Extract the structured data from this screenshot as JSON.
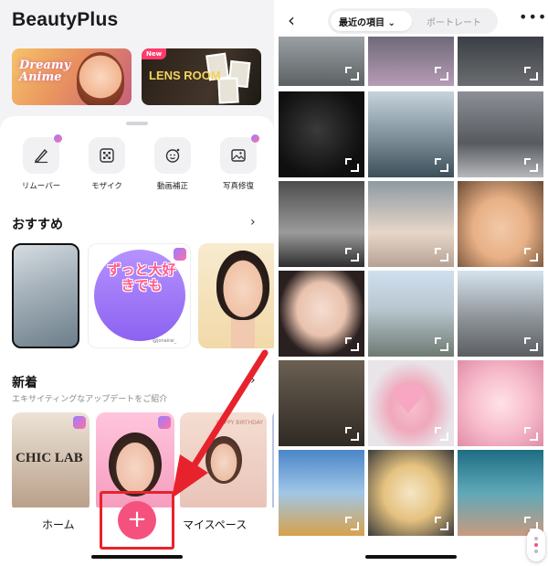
{
  "left": {
    "app_title": "BeautyPlus",
    "banners": {
      "anime_text": "Dreamy Anime",
      "lens_text": "LENS ROOM",
      "lens_badge": "New"
    },
    "tools": [
      {
        "label": "リムーバー",
        "icon": "eraser-icon"
      },
      {
        "label": "モザイク",
        "icon": "mosaic-icon"
      },
      {
        "label": "動画補正",
        "icon": "face-retouch-icon"
      },
      {
        "label": "写真修復",
        "icon": "photo-repair-icon"
      }
    ],
    "recommend": {
      "title": "おすすめ",
      "sticker_text": "ずっと大好きでも",
      "sticker_caption": "@jonairai_"
    },
    "new_section": {
      "title": "新着",
      "subtitle": "エキサイティングなアップデートをご紹介",
      "card1_text": "CHIC LAB",
      "card3_text": "HAPPY BIRTHDAY"
    },
    "tabbar": {
      "home": "ホーム",
      "add": "+",
      "my_space": "マイスペース"
    },
    "colors": {
      "accent": "#f5517e",
      "highlight": "#e8222c"
    }
  },
  "right": {
    "segment": {
      "active": "最近の項目",
      "inactive": "ポートレート"
    },
    "photos": [
      {
        "name": "photo-street-crosswalk"
      },
      {
        "name": "photo-purple-flowers"
      },
      {
        "name": "photo-dark-window"
      },
      {
        "name": "photo-shadow-sign"
      },
      {
        "name": "photo-city-bay"
      },
      {
        "name": "photo-crosswalk-city"
      },
      {
        "name": "photo-bw-street"
      },
      {
        "name": "photo-blonde-woman"
      },
      {
        "name": "photo-selfie-woman"
      },
      {
        "name": "photo-asian-woman"
      },
      {
        "name": "photo-highway-city"
      },
      {
        "name": "photo-street-traffic"
      },
      {
        "name": "photo-bottle-still-life"
      },
      {
        "name": "photo-heart-sticker-face"
      },
      {
        "name": "photo-pink-hair-girl"
      },
      {
        "name": "photo-dog-illustration"
      },
      {
        "name": "photo-sweets-plate"
      },
      {
        "name": "photo-tanned-woman"
      }
    ]
  }
}
